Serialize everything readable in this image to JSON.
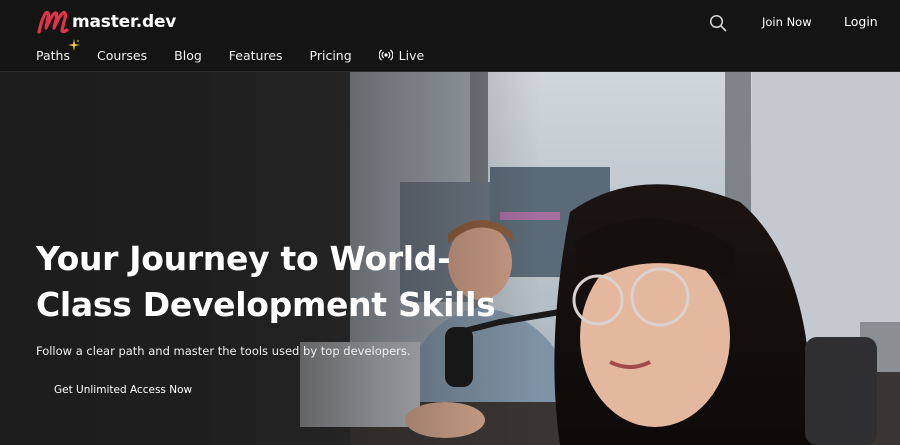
{
  "header": {
    "logo_text": "master.dev",
    "join_label": "Join Now",
    "login_label": "Login",
    "accent": "#e0334a"
  },
  "nav": {
    "items": [
      {
        "label": "Paths",
        "icon": "sparkle-icon"
      },
      {
        "label": "Courses"
      },
      {
        "label": "Blog"
      },
      {
        "label": "Features"
      },
      {
        "label": "Pricing"
      },
      {
        "label": "Live",
        "icon": "broadcast-icon"
      }
    ]
  },
  "hero": {
    "title": "Your Journey to World-Class Development Skills",
    "subtitle": "Follow a clear path and master the tools used by top developers.",
    "cta_label": "Get Unlimited Access Now"
  },
  "icons": {
    "search": "search-icon"
  }
}
